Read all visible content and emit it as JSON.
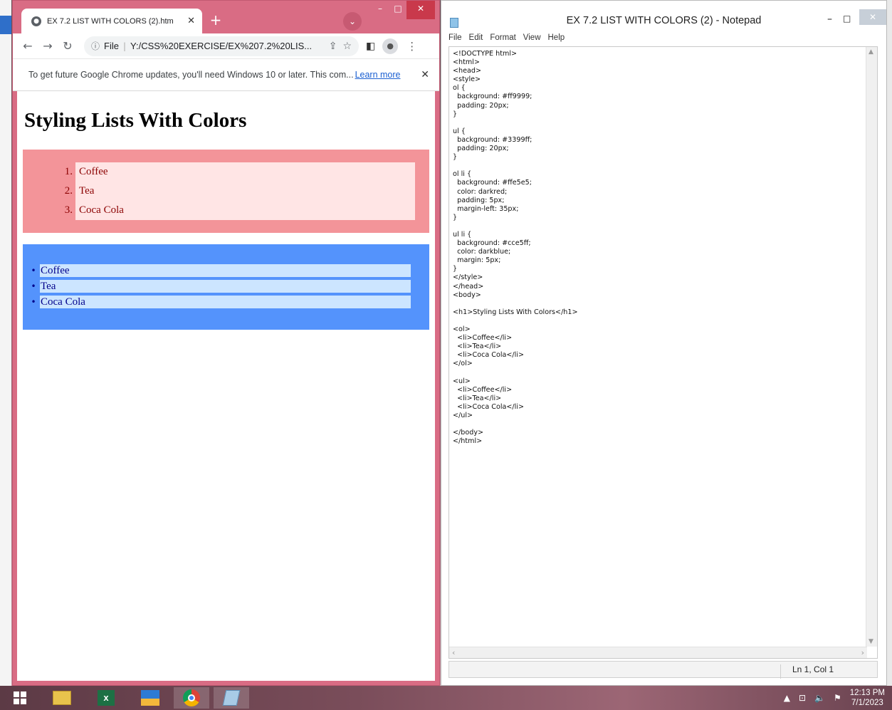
{
  "chrome": {
    "tab_title": "EX 7.2 LIST WITH COLORS (2).htm",
    "omnibox_scheme": "File",
    "omnibox_url": "Y:/CSS%20EXERCISE/EX%207.2%20LIS...",
    "infobar_message": "To get future Google Chrome updates, you'll need Windows 10 or later. This com...",
    "infobar_link": "Learn more"
  },
  "page": {
    "heading": "Styling Lists With Colors",
    "ordered_list": [
      {
        "number": "1.",
        "text": "Coffee"
      },
      {
        "number": "2.",
        "text": "Tea"
      },
      {
        "number": "3.",
        "text": "Coca Cola"
      }
    ],
    "unordered_list": [
      "Coffee",
      "Tea",
      "Coca Cola"
    ],
    "colors": {
      "ol_bg": "#ff9999",
      "ol_li_bg": "#ffe5e5",
      "ul_bg": "#3399ff",
      "ul_li_bg": "#cce5ff"
    }
  },
  "notepad": {
    "title": "EX 7.2 LIST WITH COLORS (2) - Notepad",
    "menu": [
      "File",
      "Edit",
      "Format",
      "View",
      "Help"
    ],
    "code": "<!DOCTYPE html>\n<html>\n<head>\n<style>\nol {\n  background: #ff9999;\n  padding: 20px;\n}\n\nul {\n  background: #3399ff;\n  padding: 20px;\n}\n\nol li {\n  background: #ffe5e5;\n  color: darkred;\n  padding: 5px;\n  margin-left: 35px;\n}\n\nul li {\n  background: #cce5ff;\n  color: darkblue;\n  margin: 5px;\n}\n</style>\n</head>\n<body>\n\n<h1>Styling Lists With Colors</h1>\n\n<ol>\n  <li>Coffee</li>\n  <li>Tea</li>\n  <li>Coca Cola</li>\n</ol>\n\n<ul>\n  <li>Coffee</li>\n  <li>Tea</li>\n  <li>Coca Cola</li>\n</ul>\n\n</body>\n</html>",
    "status_position": "Ln 1, Col 1"
  },
  "taskbar": {
    "excel_label": "x",
    "time": "12:13 PM",
    "date": "7/1/2023"
  }
}
